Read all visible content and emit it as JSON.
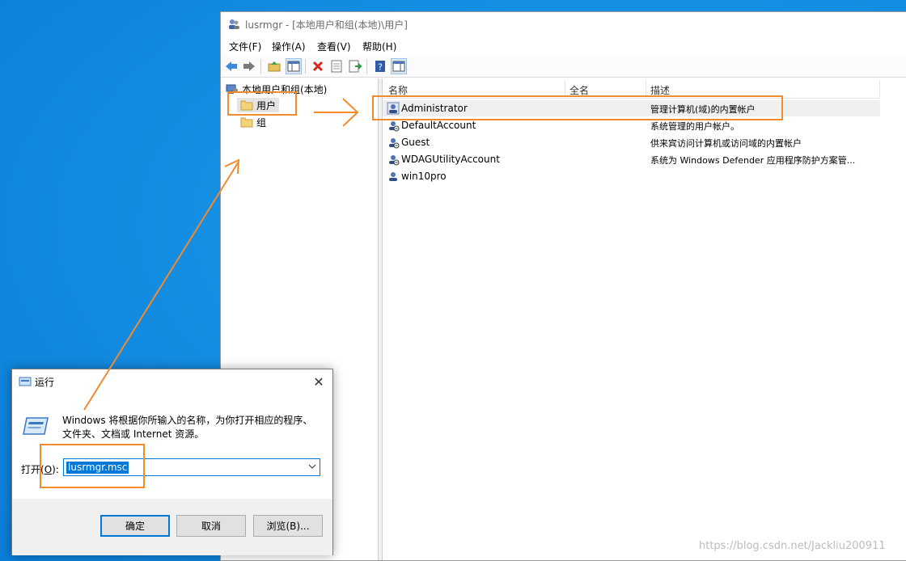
{
  "mmc": {
    "title": "lusrmgr - [本地用户和组(本地)\\用户]",
    "menu": [
      "文件(F)",
      "操作(A)",
      "查看(V)",
      "帮助(H)"
    ],
    "tree": {
      "root": "本地用户和组(本地)",
      "users": "用户",
      "groups": "组"
    },
    "columns": {
      "name": "名称",
      "fullname": "全名",
      "desc": "描述"
    },
    "rows": [
      {
        "name": "Administrator",
        "desc": "管理计算机(域)的内置帐户"
      },
      {
        "name": "DefaultAccount",
        "desc": "系统管理的用户帐户。"
      },
      {
        "name": "Guest",
        "desc": "供来宾访问计算机或访问域的内置帐户"
      },
      {
        "name": "WDAGUtilityAccount",
        "desc": "系统为 Windows Defender 应用程序防护方案管..."
      },
      {
        "name": "win10pro",
        "desc": ""
      }
    ]
  },
  "run": {
    "title": "运行",
    "desc_line1": "Windows 将根据你所输入的名称，为你打开相应的程序、",
    "desc_line2": "文件夹、文档或 Internet 资源。",
    "open_prefix": "打开(",
    "open_key": "O",
    "open_suffix": "):",
    "input_value": "lusrmgr.msc",
    "ok": "确定",
    "cancel": "取消",
    "browse": "浏览(B)..."
  },
  "watermark": "https://blog.csdn.net/Jackliu200911",
  "colors": {
    "annotation": "#f28a2e",
    "desktop": "#1a8fe0",
    "selection": "#0078d7"
  }
}
